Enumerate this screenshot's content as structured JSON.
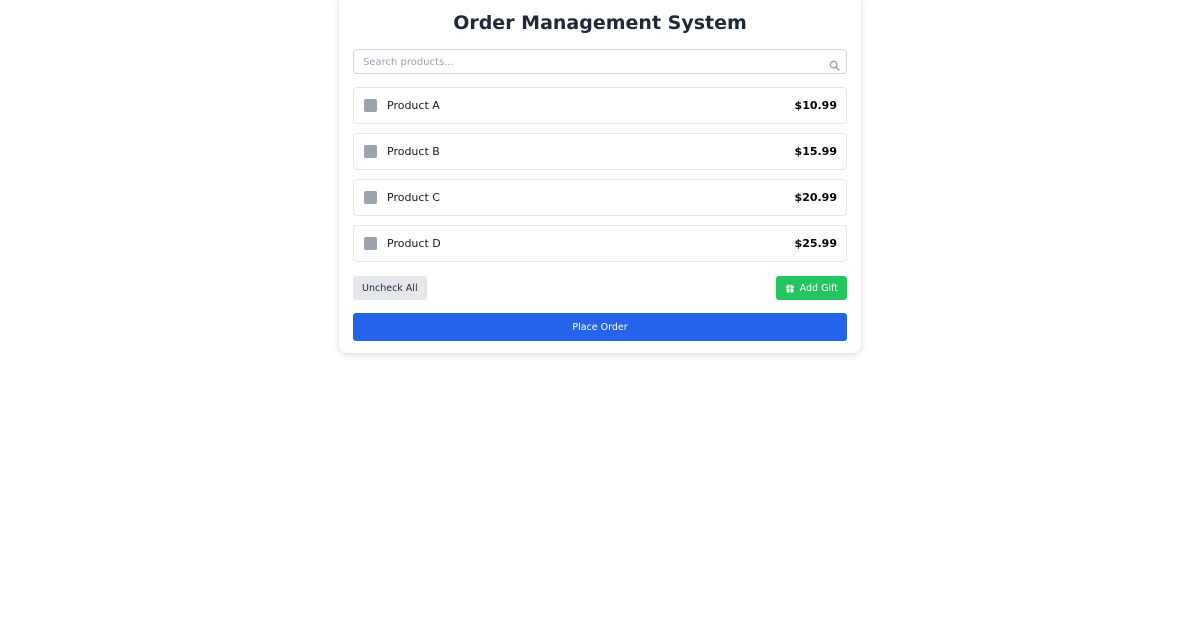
{
  "header": {
    "title": "Order Management System"
  },
  "search": {
    "placeholder": "Search products...",
    "value": ""
  },
  "products": [
    {
      "name": "Product A",
      "price": "$10.99",
      "checked": false
    },
    {
      "name": "Product B",
      "price": "$15.99",
      "checked": false
    },
    {
      "name": "Product C",
      "price": "$20.99",
      "checked": false
    },
    {
      "name": "Product D",
      "price": "$25.99",
      "checked": false
    }
  ],
  "actions": {
    "uncheck_all_label": "Uncheck All",
    "add_gift_label": "Add Gift",
    "add_gift_icon": "gift-icon",
    "place_order_label": "Place Order"
  },
  "colors": {
    "primary": "#2563eb",
    "success": "#22c55e",
    "checkbox": "#9ca3af",
    "secondary_button": "#e5e7eb"
  }
}
